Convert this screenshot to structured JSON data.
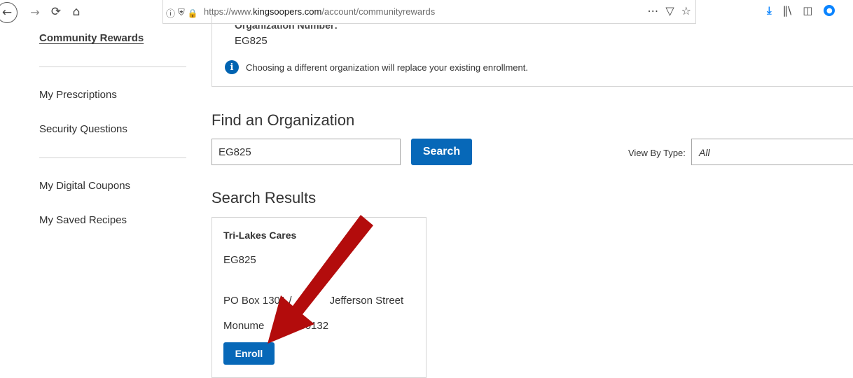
{
  "browser": {
    "url_prefix": "https://www.",
    "url_domain": "kingsoopers.com",
    "url_path": "/account/communityrewards",
    "icons": {
      "back": "back-arrow-icon",
      "forward": "forward-arrow-icon",
      "reload": "reload-icon",
      "home": "home-icon",
      "info": "info-icon",
      "tracking": "shield-icon",
      "lock": "lock-icon",
      "more": "ellipsis-icon",
      "pocket": "pocket-icon",
      "bookmark": "star-icon",
      "downloads": "download-icon",
      "library": "library-icon",
      "sidebar": "sidebar-icon",
      "account": "account-icon"
    }
  },
  "sidebar": {
    "active": "Community Rewards",
    "items": [
      "My Prescriptions",
      "Security Questions",
      "My Digital Coupons",
      "My Saved Recipes"
    ]
  },
  "enrollment": {
    "org_number_label": "Organization Number:",
    "org_number": "EG825",
    "info_text": "Choosing a different organization will replace your existing enrollment."
  },
  "find": {
    "heading": "Find an Organization",
    "search_value": "EG825",
    "search_button": "Search",
    "view_by_label": "View By Type:",
    "view_by_value": "All"
  },
  "results": {
    "heading": "Search Results",
    "card": {
      "name": "Tri-Lakes Cares",
      "code": "EG825",
      "address1_start": "PO Box 1301 /",
      "address1_end": "Jefferson Street",
      "address2_start": "Monume",
      "address2_end": "80132",
      "enroll_button": "Enroll"
    }
  },
  "colors": {
    "primary_button": "#0768b8",
    "arrow": "#b30c0c"
  }
}
